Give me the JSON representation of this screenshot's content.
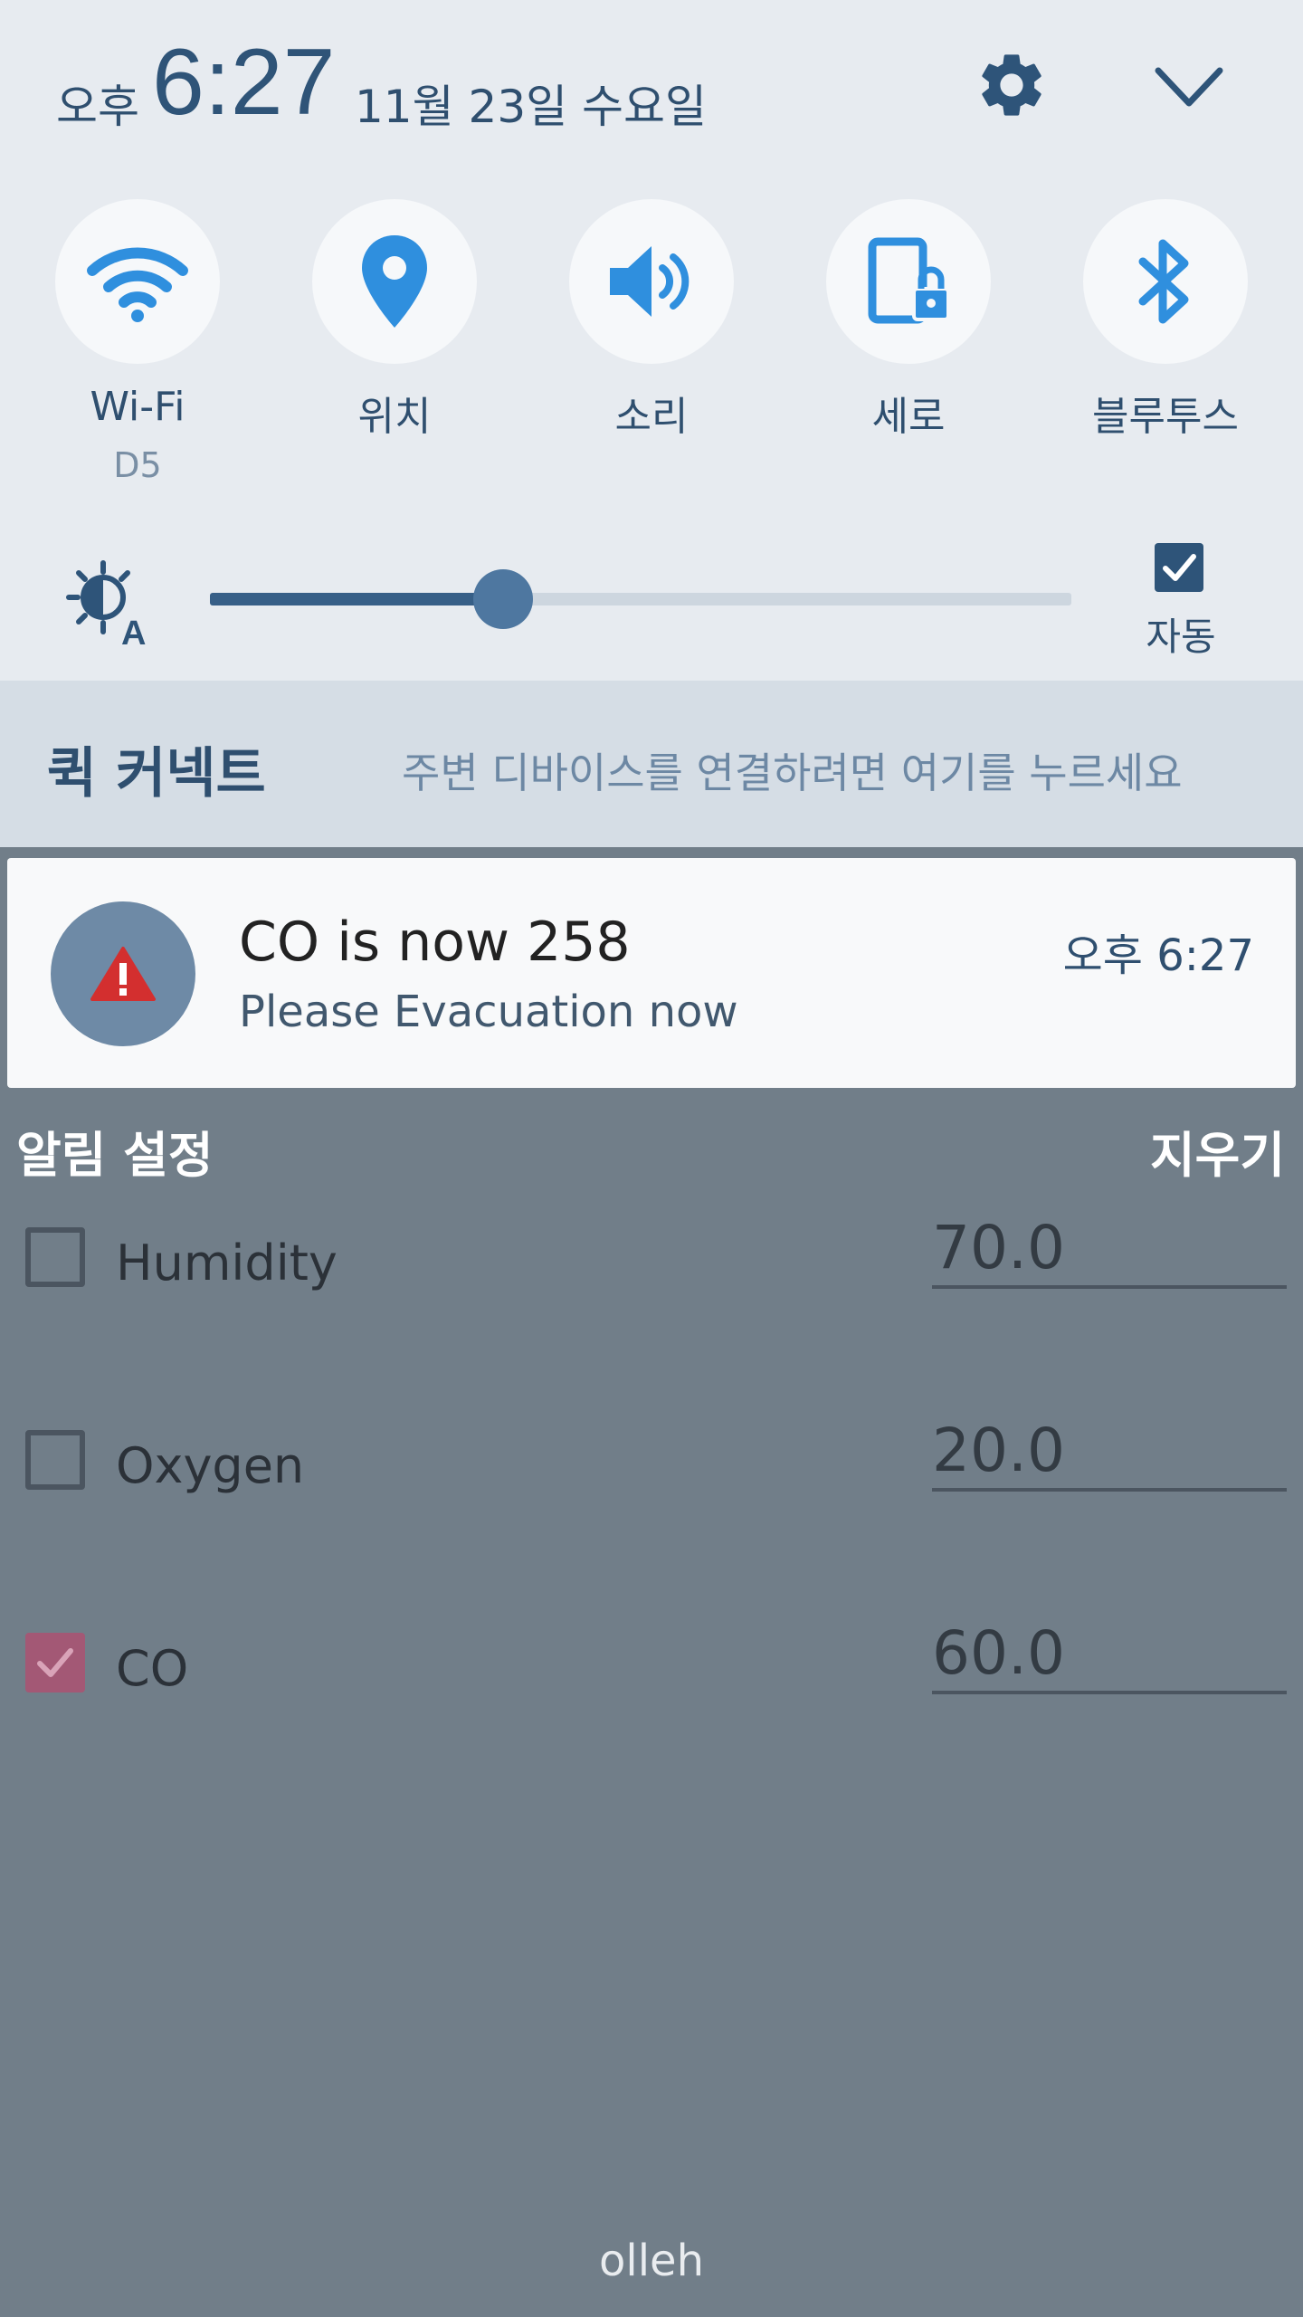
{
  "status": {
    "ampm": "오후",
    "time": "6:27",
    "date": "11월 23일 수요일"
  },
  "quick_settings": [
    {
      "label": "Wi-Fi",
      "sub": "D5",
      "icon": "wifi-icon"
    },
    {
      "label": "위치",
      "sub": "",
      "icon": "location-icon"
    },
    {
      "label": "소리",
      "sub": "",
      "icon": "sound-icon"
    },
    {
      "label": "세로",
      "sub": "",
      "icon": "rotation-lock-icon"
    },
    {
      "label": "블루투스",
      "sub": "",
      "icon": "bluetooth-icon"
    }
  ],
  "brightness": {
    "level": 0.34,
    "auto_label": "자동",
    "auto_checked": true
  },
  "quick_connect": {
    "title": "퀵 커넥트",
    "hint": "주변 디바이스를 연결하려면 여기를 누르세요"
  },
  "notification": {
    "title": "CO is now 258",
    "text": "Please Evacuation now",
    "time": "오후 6:27",
    "icon": "warning-icon"
  },
  "app": {
    "section_title": "알림 설정",
    "clear_label": "지우기",
    "settings": [
      {
        "label": "Humidity",
        "value": "70.0",
        "checked": false
      },
      {
        "label": "Oxygen",
        "value": "20.0",
        "checked": false
      },
      {
        "label": "CO",
        "value": "60.0",
        "checked": true
      }
    ]
  },
  "carrier": "olleh",
  "colors": {
    "panel_bg": "#e7ebf0",
    "accent_blue": "#2f8fde",
    "dim_overlay": "#717e89",
    "checkbox_checked": "#a35875",
    "warning_red": "#d32f2f"
  }
}
